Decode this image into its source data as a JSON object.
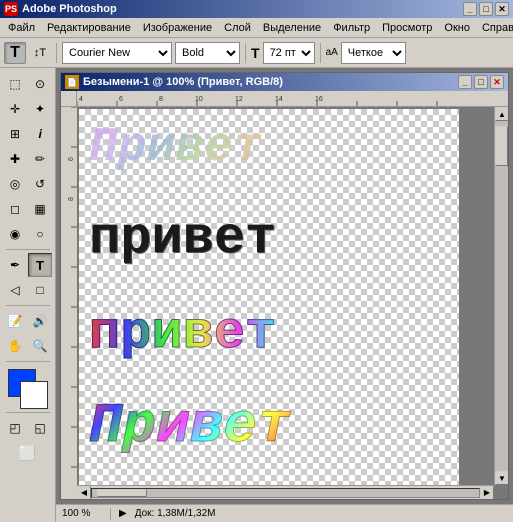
{
  "app": {
    "title": "Adobe Photoshop",
    "icon_label": "PS"
  },
  "menu": {
    "items": [
      "Файл",
      "Редактирование",
      "Изображение",
      "Слой",
      "Выделение",
      "Фильтр",
      "Просмотр",
      "Окно",
      "Справка"
    ]
  },
  "toolbar": {
    "text_tool_label": "T",
    "orientation_label": "↕T",
    "font_name": "Courier New",
    "font_style": "Bold",
    "font_size_label": "T",
    "font_size": "72 пт",
    "aa_label": "аА",
    "aa_mode": "Четкое"
  },
  "document": {
    "title": "Безымени-1 @ 100% (Привет, RGB/8)",
    "icon_label": "📄"
  },
  "canvas": {
    "texts": [
      {
        "id": "text1",
        "content": "Привет",
        "style": "italic-gradient-top"
      },
      {
        "id": "text2",
        "content": "привет",
        "style": "black-bold"
      },
      {
        "id": "text3",
        "content": "привет",
        "style": "multicolor"
      },
      {
        "id": "text4",
        "content": "Привет",
        "style": "italic-multicolor"
      }
    ]
  },
  "status": {
    "zoom": "100 %",
    "doc_label": "Док:",
    "doc_size": "1,38M/1,32M"
  },
  "colors": {
    "foreground": "#0040ff",
    "background": "#ffffff",
    "titlebar_start": "#0a246a",
    "titlebar_end": "#a6b8e0"
  }
}
